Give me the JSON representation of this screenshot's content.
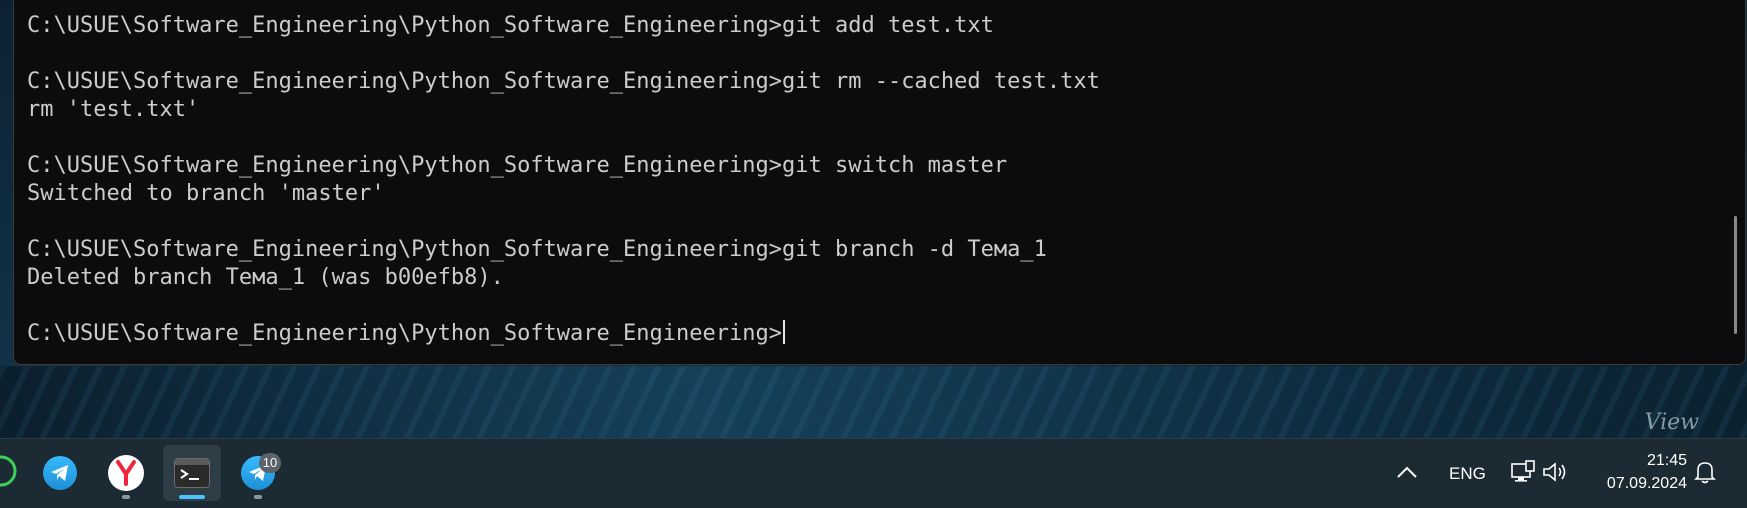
{
  "terminal": {
    "lines": [
      {
        "prompt": "C:\\USUE\\Software_Engineering\\Python_Software_Engineering>",
        "command": "git add test.txt"
      },
      {
        "text": ""
      },
      {
        "prompt": "C:\\USUE\\Software_Engineering\\Python_Software_Engineering>",
        "command": "git rm --cached test.txt"
      },
      {
        "text": "rm 'test.txt'"
      },
      {
        "text": ""
      },
      {
        "prompt": "C:\\USUE\\Software_Engineering\\Python_Software_Engineering>",
        "command": "git switch master"
      },
      {
        "text": "Switched to branch 'master'"
      },
      {
        "text": ""
      },
      {
        "prompt": "C:\\USUE\\Software_Engineering\\Python_Software_Engineering>",
        "command": "git branch -d Тема_1"
      },
      {
        "text": "Deleted branch Тема_1 (was b00efb8)."
      },
      {
        "text": ""
      },
      {
        "prompt": "C:\\USUE\\Software_Engineering\\Python_Software_Engineering>",
        "command": "",
        "cursor": true
      }
    ]
  },
  "wallpaper": {
    "watermark": "View"
  },
  "taskbar": {
    "apps": [
      {
        "name": "telegram-app",
        "icon": "telegram-icon"
      },
      {
        "name": "yandex-browser-app",
        "icon": "yandex-browser-icon"
      },
      {
        "name": "terminal-app",
        "icon": "terminal-icon",
        "active": true
      },
      {
        "name": "telegram-app-2",
        "icon": "telegram-icon",
        "badge": "10"
      }
    ],
    "tray": {
      "chevron_icon": "chevron-up-icon",
      "language": "ENG",
      "network_icon": "network-icon",
      "volume_icon": "volume-icon",
      "time": "21:45",
      "date": "07.09.2024",
      "notification_icon": "bell-icon"
    }
  },
  "colors": {
    "terminal_bg": "#0c0c0c",
    "terminal_text": "#cccccc",
    "taskbar_bg": "#1c2a33",
    "accent": "#4cc2ff"
  }
}
